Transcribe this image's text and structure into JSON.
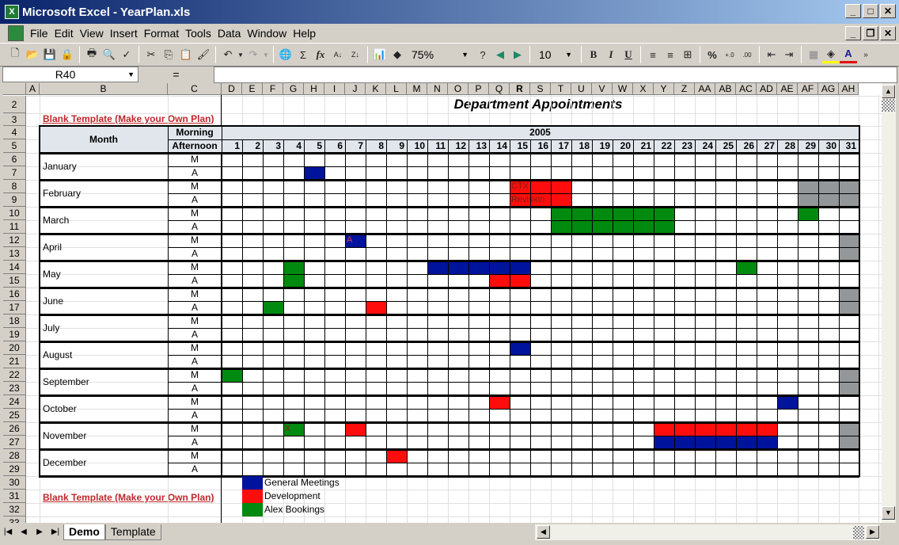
{
  "window": {
    "title": "Microsoft Excel - YearPlan.xls",
    "minimize": "_",
    "maximize": "□",
    "close": "✕",
    "restore": "🗗"
  },
  "menu": [
    "File",
    "Edit",
    "View",
    "Insert",
    "Format",
    "Tools",
    "Data",
    "Window",
    "Help"
  ],
  "toolbar": {
    "icons": [
      "new-icon",
      "open-icon",
      "save-icon",
      "permission-icon",
      "print-icon",
      "print-preview-icon",
      "spelling-icon",
      "cut-icon",
      "copy-icon",
      "paste-icon",
      "format-painter-icon",
      "undo-icon",
      "redo-icon",
      "hyperlink-icon",
      "autosum-icon",
      "function-icon",
      "sort-ascending-icon",
      "sort-descending-icon",
      "chart-wizard-icon",
      "drawing-icon"
    ],
    "zoom": "75%",
    "font_size": "10",
    "bold": "B",
    "italic": "I",
    "underline": "U",
    "percent": "%"
  },
  "formula_bar": {
    "name_box": "R40",
    "equals": "=",
    "formula": ""
  },
  "columns": [
    "A",
    "B",
    "C",
    "D",
    "E",
    "F",
    "G",
    "H",
    "I",
    "J",
    "K",
    "L",
    "M",
    "N",
    "O",
    "P",
    "Q",
    "R",
    "S",
    "T",
    "U",
    "V",
    "W",
    "X",
    "Y",
    "Z",
    "AA",
    "AB",
    "AC",
    "AD",
    "AE",
    "AF",
    "AG",
    "AH"
  ],
  "selected_column": "R",
  "rows": [
    "2",
    "3",
    "4",
    "5",
    "6",
    "7",
    "8",
    "9",
    "10",
    "11",
    "12",
    "13",
    "14",
    "15",
    "16",
    "17",
    "18",
    "19",
    "20",
    "21",
    "22",
    "23",
    "24",
    "25",
    "26",
    "27",
    "28",
    "29",
    "30",
    "31",
    "32",
    "33"
  ],
  "sheet": {
    "title": "Department Appointments",
    "template_link": "Blank Template (Make your Own Plan)",
    "month_header": "Month",
    "morning_header": "Morning",
    "afternoon_header": "Afternoon",
    "year": "2005",
    "days": [
      "1",
      "2",
      "3",
      "4",
      "5",
      "6",
      "7",
      "8",
      "9",
      "10",
      "11",
      "12",
      "13",
      "14",
      "15",
      "16",
      "17",
      "18",
      "19",
      "20",
      "21",
      "22",
      "23",
      "24",
      "25",
      "26",
      "27",
      "28",
      "29",
      "30",
      "31"
    ],
    "months": [
      "January",
      "February",
      "March",
      "April",
      "May",
      "June",
      "July",
      "August",
      "September",
      "October",
      "November",
      "December"
    ],
    "m_label": "M",
    "a_label": "A"
  },
  "colors": {
    "meeting": "#00139c",
    "development": "#ff0d0d",
    "alex": "#008a0f",
    "unavailable": "#939799"
  },
  "bookings": [
    {
      "month": 1,
      "slot": "A",
      "from": 5,
      "to": 5,
      "type": "meeting"
    },
    {
      "month": 2,
      "slot": "M",
      "from": 15,
      "to": 17,
      "type": "development",
      "text": "CTX"
    },
    {
      "month": 2,
      "slot": "A",
      "from": 15,
      "to": 17,
      "type": "development",
      "text": "Revision"
    },
    {
      "month": 2,
      "slot": "M",
      "from": 29,
      "to": 31,
      "type": "unavailable"
    },
    {
      "month": 2,
      "slot": "A",
      "from": 29,
      "to": 31,
      "type": "unavailable"
    },
    {
      "month": 3,
      "slot": "M",
      "from": 17,
      "to": 22,
      "type": "alex"
    },
    {
      "month": 3,
      "slot": "A",
      "from": 17,
      "to": 22,
      "type": "alex"
    },
    {
      "month": 3,
      "slot": "M",
      "from": 29,
      "to": 29,
      "type": "alex"
    },
    {
      "month": 4,
      "slot": "M",
      "from": 7,
      "to": 7,
      "type": "meeting",
      "text": "A"
    },
    {
      "month": 4,
      "slot": "M",
      "from": 31,
      "to": 31,
      "type": "unavailable"
    },
    {
      "month": 4,
      "slot": "A",
      "from": 31,
      "to": 31,
      "type": "unavailable"
    },
    {
      "month": 5,
      "slot": "M",
      "from": 4,
      "to": 4,
      "type": "alex"
    },
    {
      "month": 5,
      "slot": "A",
      "from": 4,
      "to": 4,
      "type": "alex"
    },
    {
      "month": 5,
      "slot": "M",
      "from": 11,
      "to": 15,
      "type": "meeting"
    },
    {
      "month": 5,
      "slot": "A",
      "from": 14,
      "to": 15,
      "type": "development"
    },
    {
      "month": 5,
      "slot": "M",
      "from": 26,
      "to": 26,
      "type": "alex"
    },
    {
      "month": 6,
      "slot": "A",
      "from": 3,
      "to": 3,
      "type": "alex"
    },
    {
      "month": 6,
      "slot": "A",
      "from": 8,
      "to": 8,
      "type": "development"
    },
    {
      "month": 6,
      "slot": "M",
      "from": 31,
      "to": 31,
      "type": "unavailable"
    },
    {
      "month": 6,
      "slot": "A",
      "from": 31,
      "to": 31,
      "type": "unavailable"
    },
    {
      "month": 8,
      "slot": "M",
      "from": 15,
      "to": 15,
      "type": "meeting"
    },
    {
      "month": 9,
      "slot": "M",
      "from": 1,
      "to": 1,
      "type": "alex"
    },
    {
      "month": 9,
      "slot": "M",
      "from": 31,
      "to": 31,
      "type": "unavailable"
    },
    {
      "month": 9,
      "slot": "A",
      "from": 31,
      "to": 31,
      "type": "unavailable"
    },
    {
      "month": 10,
      "slot": "M",
      "from": 14,
      "to": 14,
      "type": "development"
    },
    {
      "month": 10,
      "slot": "M",
      "from": 28,
      "to": 28,
      "type": "meeting"
    },
    {
      "month": 11,
      "slot": "M",
      "from": 4,
      "to": 4,
      "type": "alex",
      "text": "X"
    },
    {
      "month": 11,
      "slot": "M",
      "from": 7,
      "to": 7,
      "type": "development"
    },
    {
      "month": 11,
      "slot": "M",
      "from": 22,
      "to": 27,
      "type": "development"
    },
    {
      "month": 11,
      "slot": "A",
      "from": 22,
      "to": 27,
      "type": "meeting"
    },
    {
      "month": 11,
      "slot": "M",
      "from": 31,
      "to": 31,
      "type": "unavailable"
    },
    {
      "month": 11,
      "slot": "A",
      "from": 31,
      "to": 31,
      "type": "unavailable"
    },
    {
      "month": 12,
      "slot": "M",
      "from": 9,
      "to": 9,
      "type": "development"
    }
  ],
  "legend": [
    {
      "label": "General Meetings",
      "type": "meeting"
    },
    {
      "label": "Development",
      "type": "development"
    },
    {
      "label": "Alex Bookings",
      "type": "alex"
    }
  ],
  "sheet_tabs": [
    {
      "label": "Demo",
      "active": true
    },
    {
      "label": "Template",
      "active": false
    }
  ]
}
